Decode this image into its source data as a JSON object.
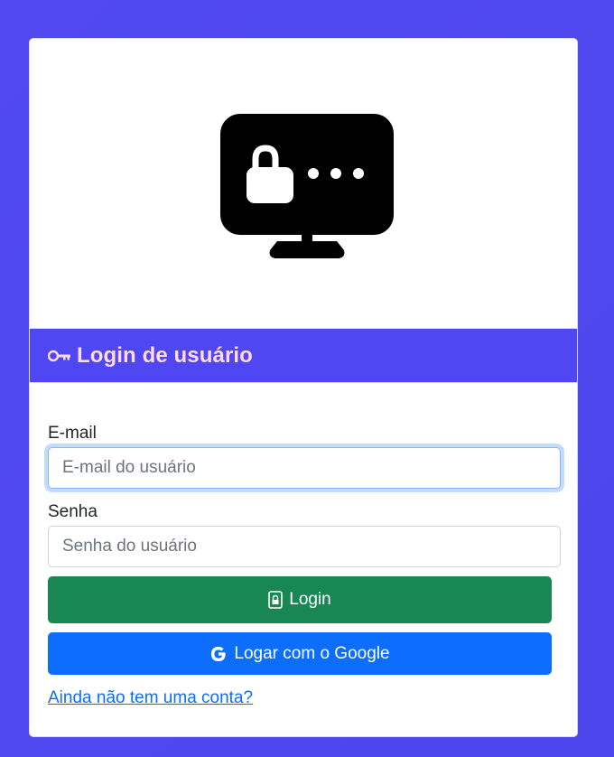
{
  "hero": {
    "icon": "monitor-password-icon"
  },
  "header": {
    "icon": "key-icon",
    "title": "Login de usuário"
  },
  "form": {
    "email_label": "E-mail",
    "email_placeholder": "E-mail do usuário",
    "email_value": "",
    "password_label": "Senha",
    "password_placeholder": "Senha do usuário",
    "password_value": ""
  },
  "buttons": {
    "login_label": "Login",
    "login_icon": "lock-icon",
    "google_label": "Logar com o Google",
    "google_icon": "google-icon"
  },
  "link": {
    "signup_label": "Ainda não tem uma conta?"
  },
  "colors": {
    "background": "#4f47f2",
    "header": "#4f47f2",
    "header_text": "#ffd9ee",
    "login_button": "#198754",
    "google_button": "#0d6efd",
    "link": "#0d6efd"
  }
}
